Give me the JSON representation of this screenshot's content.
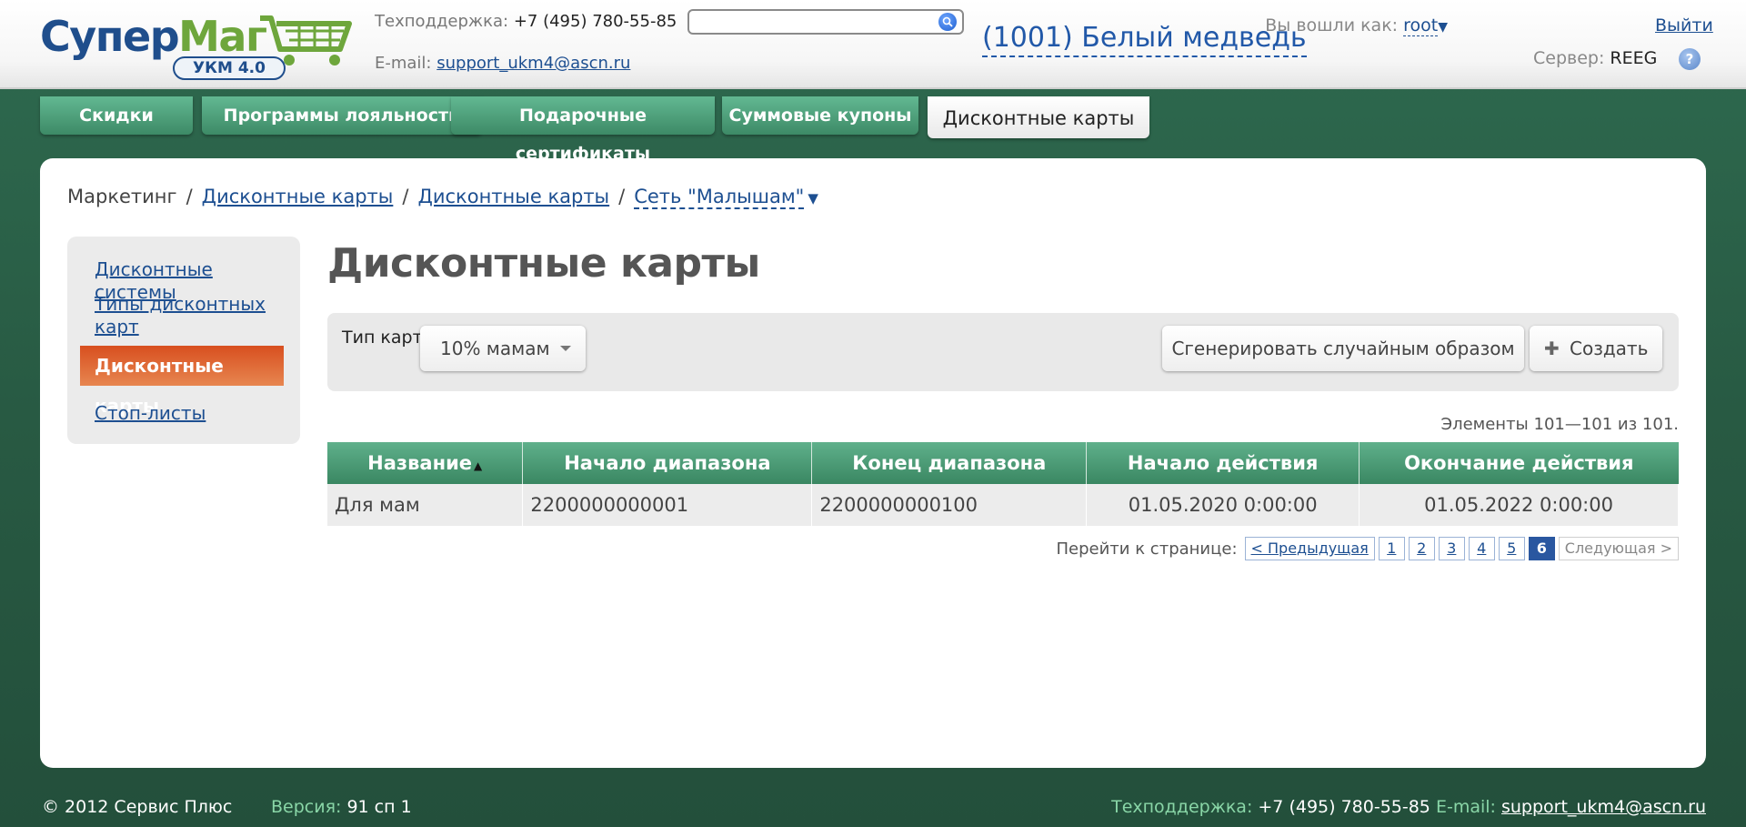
{
  "header": {
    "logo": {
      "part1": "Супер",
      "part2": "Маг",
      "badge": "УКМ 4.0"
    },
    "support_label": "Техподдержка:",
    "support_phone": "+7 (495) 780-55-85",
    "email_label": "E-mail:",
    "email": "support_ukm4@ascn.ru",
    "search": {
      "value": "",
      "placeholder": ""
    },
    "store_name": "(1001) Белый медведь",
    "login_label": "Вы вошли как:",
    "user": "root",
    "logout": "Выйти",
    "server_label": "Сервер:",
    "server": "REEG",
    "help": "?"
  },
  "tabs": [
    {
      "label": "Скидки"
    },
    {
      "label": "Программы лояльности"
    },
    {
      "label": "Подарочные сертификаты"
    },
    {
      "label": "Суммовые купоны"
    },
    {
      "label": "Дисконтные карты",
      "active": true
    }
  ],
  "breadcrumb": {
    "root": "Маркетинг",
    "sep": "/",
    "l1": "Дисконтные карты",
    "l2": "Дисконтные карты",
    "l3": "Сеть \"Малышам\""
  },
  "sidebar": {
    "items": [
      {
        "label": "Дисконтные системы"
      },
      {
        "label": "Типы дисконтных карт"
      },
      {
        "label": "Дисконтные карты",
        "active": true
      },
      {
        "label": "Стоп-листы"
      }
    ]
  },
  "main": {
    "title": "Дисконтные карты",
    "filter_label": "Тип карт:",
    "filter_value": "10% мамам",
    "generate_label": "Сгенерировать случайным образом",
    "create_label": "Создать",
    "count_text": "Элементы 101—101 из 101.",
    "table": {
      "columns": [
        "Название",
        "Начало диапазона",
        "Конец диапазона",
        "Начало действия",
        "Окончание действия"
      ],
      "rows": [
        [
          "Для мам",
          "2200000000001",
          "2200000000100",
          "01.05.2020 0:00:00",
          "01.05.2022 0:00:00"
        ]
      ]
    },
    "pager": {
      "goto_label": "Перейти к странице:",
      "prev": "< Предыдущая",
      "pages": [
        "1",
        "2",
        "3",
        "4",
        "5",
        "6"
      ],
      "current": "6",
      "next": "Следующая >"
    }
  },
  "footer": {
    "copyright": "© 2012 Сервис Плюс",
    "version_label": "Версия:",
    "version": "91 сп 1",
    "support_label": "Техподдержка:",
    "support_phone": "+7 (495) 780-55-85",
    "email_label": "E-mail:",
    "email": "support_ukm4@ascn.ru"
  },
  "colors": {
    "background": "#2a5d46",
    "tab_green": "#4c9f79",
    "link": "#1d4f91",
    "active_nav": "#d8561f",
    "current_page": "#2a57a0"
  }
}
